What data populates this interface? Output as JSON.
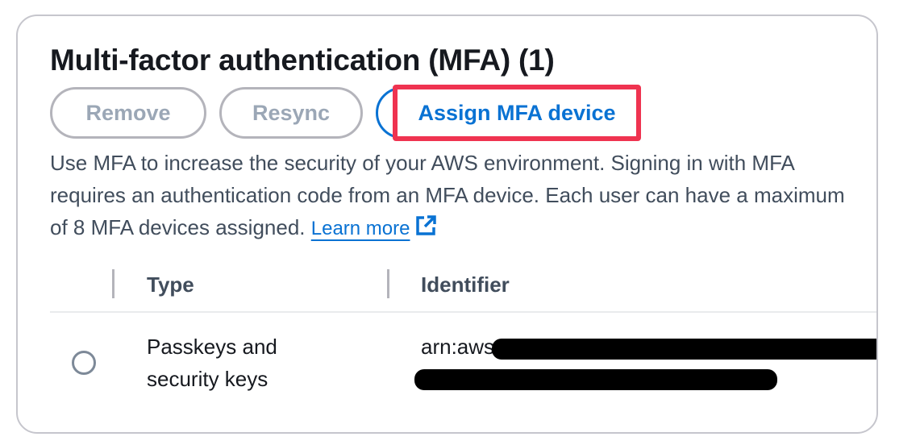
{
  "panel": {
    "title": "Multi-factor authentication (MFA) (1)",
    "buttons": {
      "remove": "Remove",
      "resync": "Resync",
      "assign": "Assign MFA device"
    },
    "description": "Use MFA to increase the security of your AWS environment. Signing in with MFA requires an authentication code from an MFA device. Each user can have a maximum of 8 MFA devices assigned.",
    "learn_more": "Learn more"
  },
  "table": {
    "columns": [
      "Type",
      "Identifier"
    ],
    "rows": [
      {
        "type_line1": "Passkeys and",
        "type_line2": "security keys",
        "identifier_prefix": "arn:aws"
      }
    ]
  },
  "colors": {
    "accent": "#0972d3",
    "highlight": "#ef3350",
    "disabled": "#9ba7b6"
  }
}
